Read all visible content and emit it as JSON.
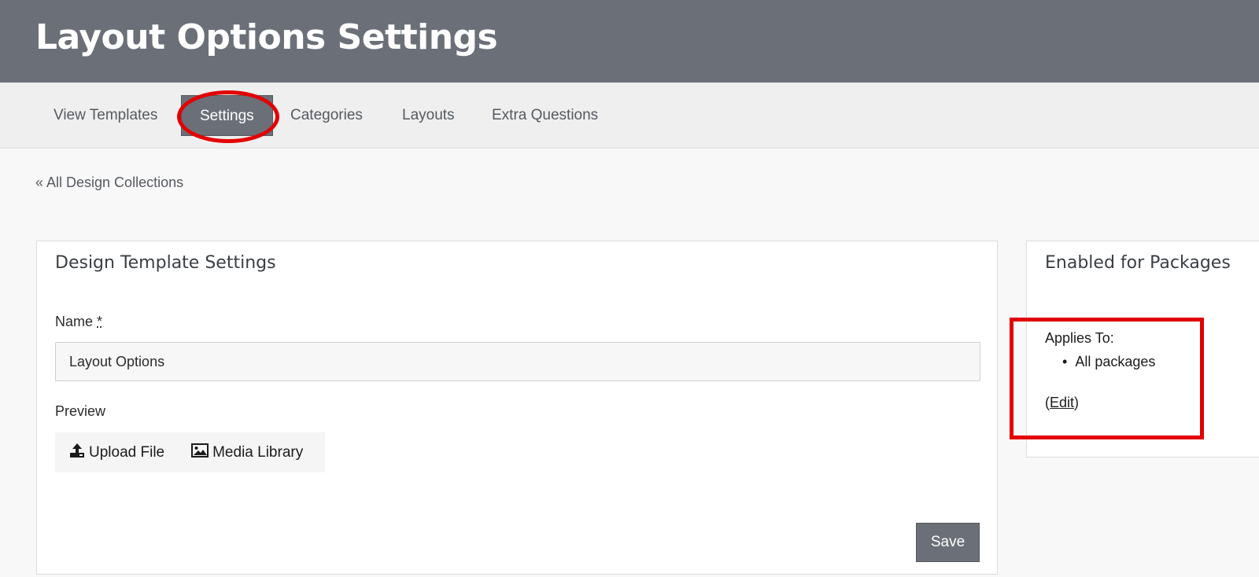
{
  "header": {
    "title": "Layout Options Settings"
  },
  "tabs": [
    {
      "label": "View Templates",
      "active": false
    },
    {
      "label": "Settings",
      "active": true
    },
    {
      "label": "Categories",
      "active": false
    },
    {
      "label": "Layouts",
      "active": false
    },
    {
      "label": "Extra Questions",
      "active": false
    }
  ],
  "back_link": "« All Design Collections",
  "main_card": {
    "title": "Design Template Settings",
    "name_label": "Name",
    "name_required": "*",
    "name_value": "Layout Options",
    "preview_label": "Preview",
    "upload_label": "Upload File",
    "media_label": "Media Library",
    "save_label": "Save"
  },
  "side_card": {
    "title": "Enabled for Packages",
    "applies_label": "Applies To:",
    "packages": [
      "All packages"
    ],
    "edit_open": "(",
    "edit_label": "Edit",
    "edit_close": ")"
  },
  "colors": {
    "header_bg": "#6b7078",
    "highlight": "#e30000",
    "active_tab_bg": "#6b7078"
  },
  "icons": [
    "upload-icon",
    "image-icon"
  ]
}
